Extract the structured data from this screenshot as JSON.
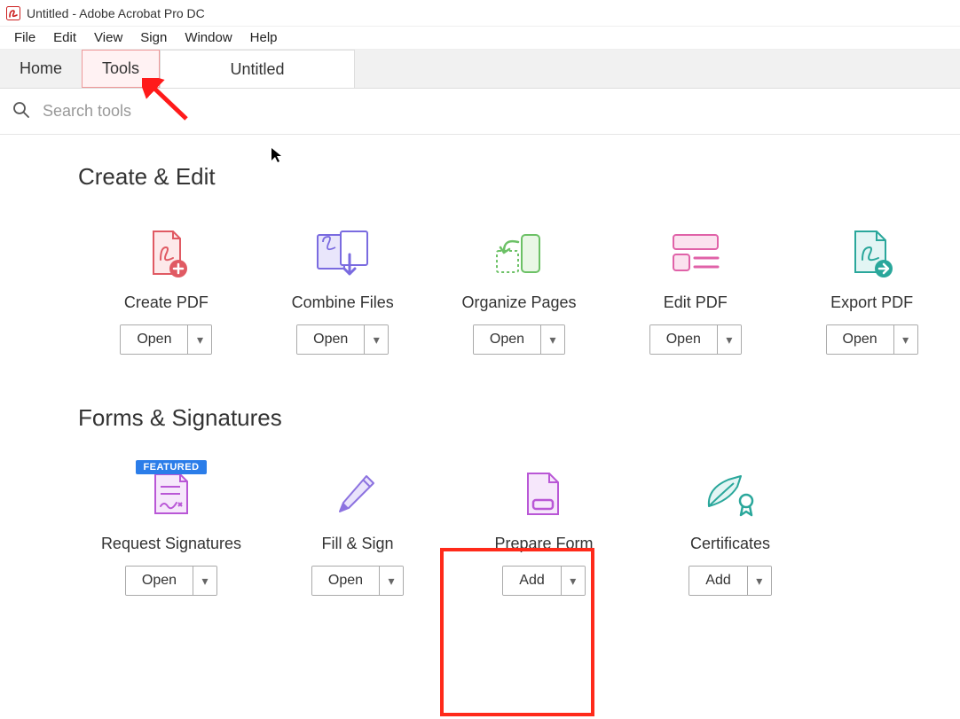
{
  "titlebar": {
    "title": "Untitled - Adobe Acrobat Pro DC"
  },
  "menubar": {
    "items": [
      "File",
      "Edit",
      "View",
      "Sign",
      "Window",
      "Help"
    ]
  },
  "tabs": {
    "home": "Home",
    "tools": "Tools",
    "doc": "Untitled"
  },
  "search": {
    "placeholder": "Search tools"
  },
  "sections": {
    "create_edit": {
      "title": "Create & Edit",
      "tools": [
        {
          "label": "Create PDF",
          "action": "Open"
        },
        {
          "label": "Combine Files",
          "action": "Open"
        },
        {
          "label": "Organize Pages",
          "action": "Open"
        },
        {
          "label": "Edit PDF",
          "action": "Open"
        },
        {
          "label": "Export PDF",
          "action": "Open"
        }
      ]
    },
    "forms_sigs": {
      "title": "Forms & Signatures",
      "tools": [
        {
          "label": "Request Signatures",
          "action": "Open",
          "featured": "FEATURED"
        },
        {
          "label": "Fill & Sign",
          "action": "Open"
        },
        {
          "label": "Prepare Form",
          "action": "Add"
        },
        {
          "label": "Certificates",
          "action": "Add"
        }
      ]
    }
  },
  "annotations": {
    "arrow_target": "Tools tab",
    "box_target": "Prepare Form"
  }
}
